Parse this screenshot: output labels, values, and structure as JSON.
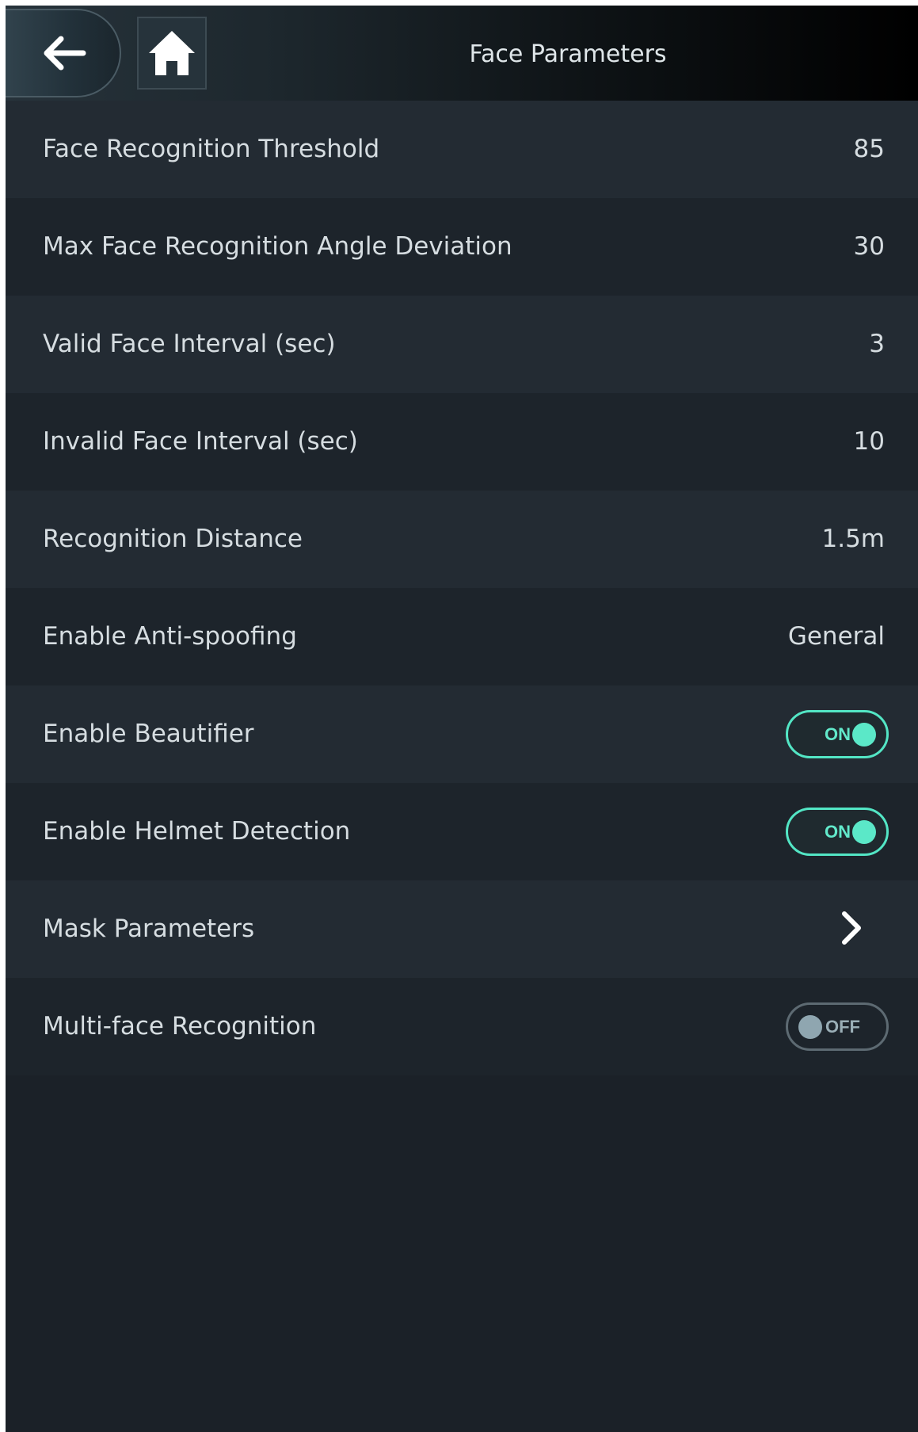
{
  "header": {
    "title": "Face Parameters",
    "back_icon": "arrow-left-icon",
    "home_icon": "home-icon"
  },
  "colors": {
    "accent": "#53e6c5",
    "background": "#1b2128",
    "row_light": "#232b33",
    "row_dark": "#1d242b",
    "text": "#d6dde1"
  },
  "settings": [
    {
      "label": "Face Recognition Threshold",
      "value": "85"
    },
    {
      "label": "Max Face Recognition Angle Deviation",
      "value": "30"
    },
    {
      "label": "Valid Face Interval (sec)",
      "value": "3"
    },
    {
      "label": "Invalid Face Interval (sec)",
      "value": "10"
    },
    {
      "label": "Recognition Distance",
      "value": "1.5m"
    },
    {
      "label": "Enable Anti-spoofing",
      "value": "General"
    },
    {
      "label": "Enable Beautifier",
      "toggle": "ON"
    },
    {
      "label": "Enable Helmet Detection",
      "toggle": "ON"
    },
    {
      "label": "Mask Parameters",
      "icon": "chevron-right-icon"
    },
    {
      "label": "Multi-face Recognition",
      "toggle": "OFF"
    }
  ]
}
